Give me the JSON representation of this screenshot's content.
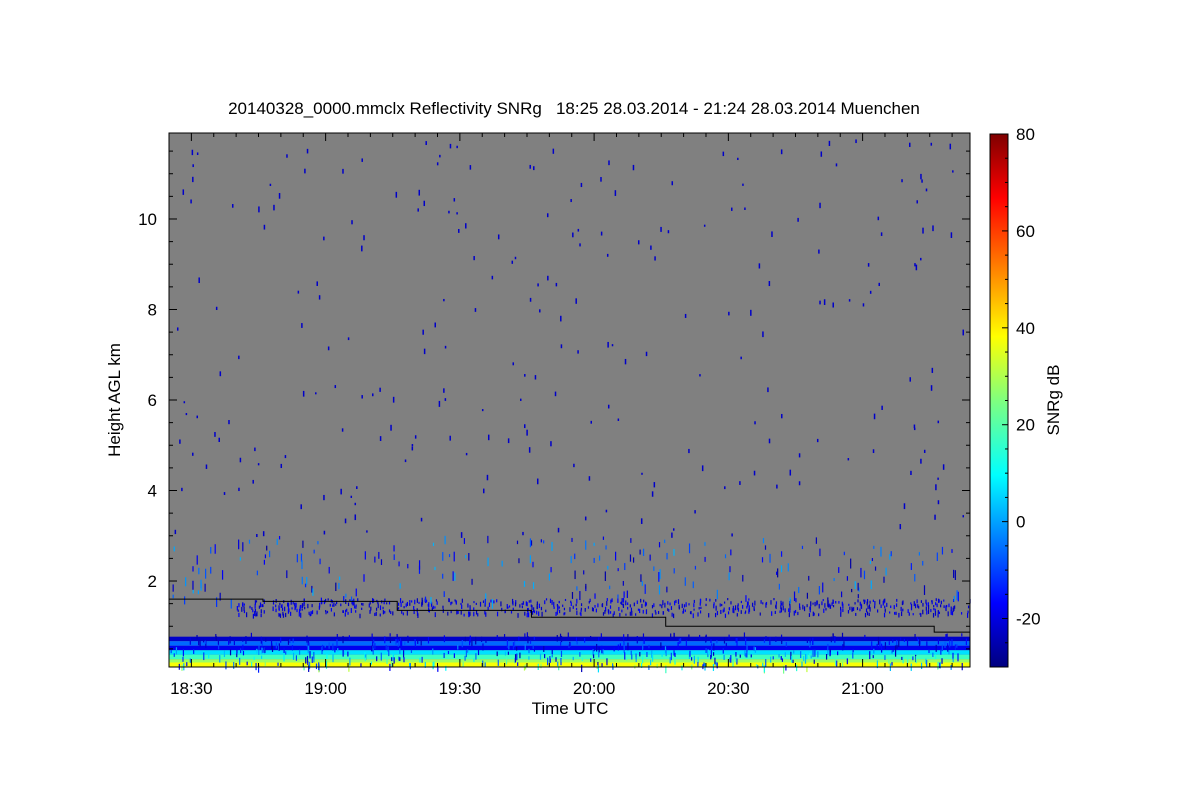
{
  "chart_data": {
    "type": "heatmap",
    "title": "20140328_0000.mmclx Reflectivity SNRg   18:25 28.03.2014 - 21:24 28.03.2014 Muenchen",
    "xlabel": "Time UTC",
    "ylabel": "Height AGL km",
    "colorbar_label": "SNRg dB",
    "x_range": [
      "18:25",
      "21:24"
    ],
    "ylim": [
      0.1,
      11.9
    ],
    "colorbar_range": [
      -30,
      80
    ],
    "x_ticks": [
      "18:30",
      "19:00",
      "19:30",
      "20:00",
      "20:30",
      "21:00"
    ],
    "y_ticks": [
      2,
      4,
      6,
      8,
      10
    ],
    "colorbar_ticks": [
      -20,
      0,
      20,
      40,
      60,
      80
    ],
    "background_color": "#808080",
    "colormap": [
      "#00007f",
      "#0000ff",
      "#007fff",
      "#00ffff",
      "#7fff7f",
      "#ffff00",
      "#ff7f00",
      "#ff0000",
      "#7f0000"
    ],
    "boundary_layer_line": {
      "color": "#000000",
      "points": [
        {
          "time": "18:25",
          "height_km": 1.6
        },
        {
          "time": "18:46",
          "height_km": 1.6
        },
        {
          "time": "18:46",
          "height_km": 1.55
        },
        {
          "time": "19:16",
          "height_km": 1.55
        },
        {
          "time": "19:16",
          "height_km": 1.35
        },
        {
          "time": "19:46",
          "height_km": 1.35
        },
        {
          "time": "19:46",
          "height_km": 1.2
        },
        {
          "time": "20:16",
          "height_km": 1.2
        },
        {
          "time": "20:16",
          "height_km": 1.0
        },
        {
          "time": "21:16",
          "height_km": 1.0
        },
        {
          "time": "21:16",
          "height_km": 0.87
        },
        {
          "time": "21:24",
          "height_km": 0.87
        }
      ]
    },
    "lowest_levels": [
      {
        "height_km": 0.72,
        "snr_db": -22
      },
      {
        "height_km": 0.62,
        "snr_db": -5
      },
      {
        "height_km": 0.52,
        "snr_db": -18
      },
      {
        "height_km": 0.42,
        "snr_db": 8
      },
      {
        "height_km": 0.32,
        "snr_db": 18
      },
      {
        "height_km": 0.22,
        "snr_db": 28
      },
      {
        "height_km": 0.15,
        "snr_db": 38
      }
    ],
    "aerosol_layer": {
      "height_km": 1.45,
      "snr_db": -20
    },
    "scatter_snr_db": -22
  }
}
